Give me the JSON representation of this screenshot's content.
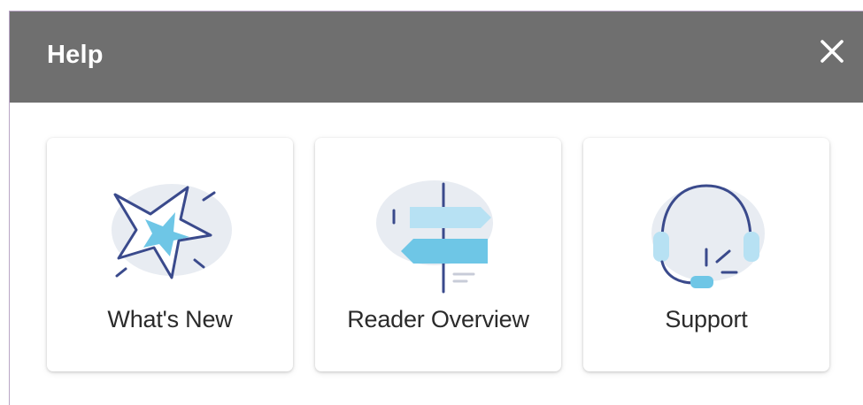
{
  "header": {
    "title": "Help",
    "close_icon": "close-icon"
  },
  "cards": [
    {
      "label": "What's New",
      "icon": "starburst-icon"
    },
    {
      "label": "Reader Overview",
      "icon": "signpost-icon"
    },
    {
      "label": "Support",
      "icon": "headset-icon"
    }
  ],
  "colors": {
    "header_bg": "#6f6f6f",
    "icon_outline": "#3a4a8c",
    "icon_fill": "#6ec6e6",
    "icon_bg": "#e8ecf2"
  }
}
